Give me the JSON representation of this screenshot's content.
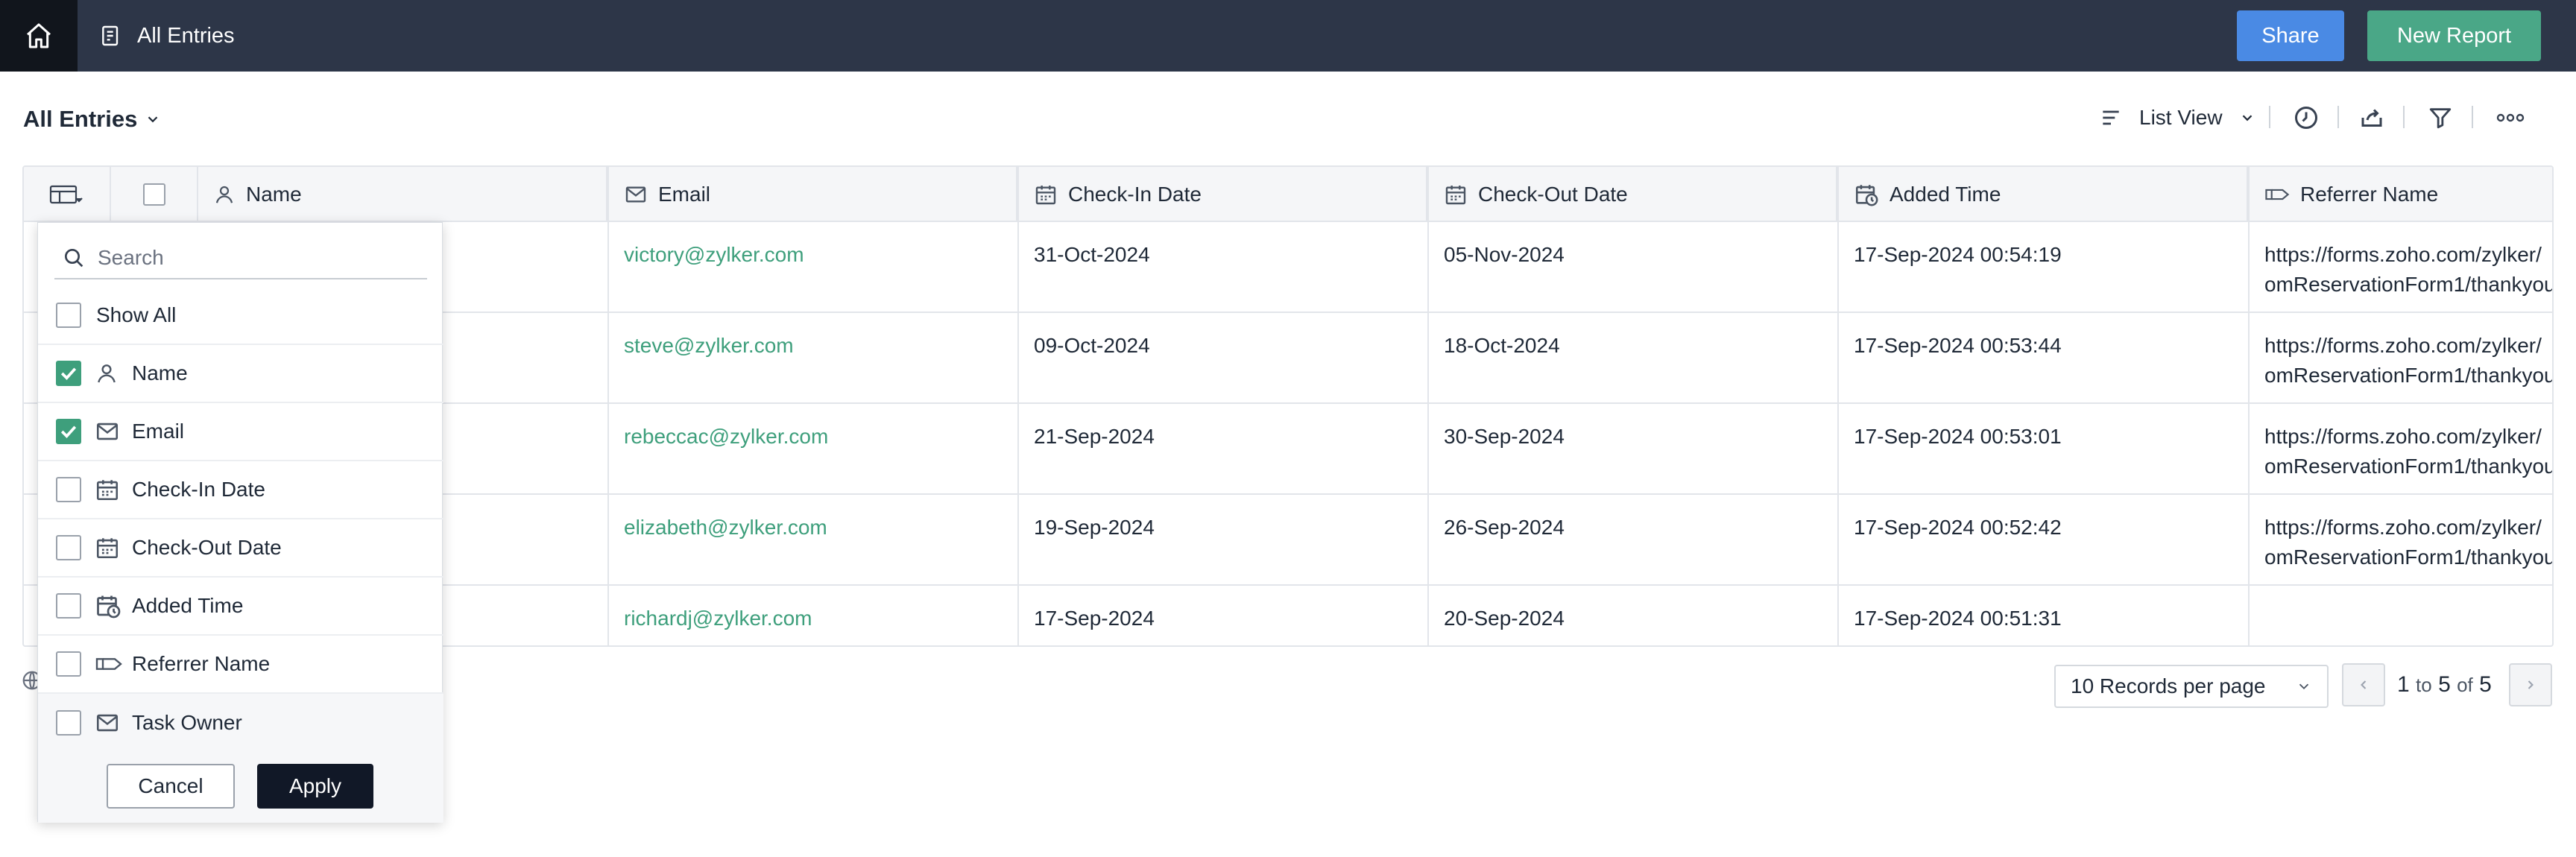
{
  "topbar": {
    "title": "All Entries",
    "share_label": "Share",
    "new_report_label": "New Report"
  },
  "view": {
    "title": "All Entries",
    "list_view_label": "List View"
  },
  "table": {
    "columns": [
      {
        "label": "Name",
        "icon": "person-icon"
      },
      {
        "label": "Email",
        "icon": "mail-icon"
      },
      {
        "label": "Check-In Date",
        "icon": "calendar-icon"
      },
      {
        "label": "Check-Out Date",
        "icon": "calendar-icon"
      },
      {
        "label": "Added Time",
        "icon": "calendar-clock-icon"
      },
      {
        "label": "Referrer Name",
        "icon": "referrer-icon"
      }
    ],
    "rows": [
      {
        "email": "victory@zylker.com",
        "checkin": "31-Oct-2024",
        "checkout": "05-Nov-2024",
        "added": "17-Sep-2024 00:54:19",
        "ref1": "https://forms.zoho.com/zylker/",
        "ref2": "omReservationForm1/thankyou"
      },
      {
        "email": "steve@zylker.com",
        "checkin": "09-Oct-2024",
        "checkout": "18-Oct-2024",
        "added": "17-Sep-2024 00:53:44",
        "ref1": "https://forms.zoho.com/zylker/",
        "ref2": "omReservationForm1/thankyou"
      },
      {
        "email": "rebeccac@zylker.com",
        "checkin": "21-Sep-2024",
        "checkout": "30-Sep-2024",
        "added": "17-Sep-2024 00:53:01",
        "ref1": "https://forms.zoho.com/zylker/",
        "ref2": "omReservationForm1/thankyou"
      },
      {
        "email": "elizabeth@zylker.com",
        "checkin": "19-Sep-2024",
        "checkout": "26-Sep-2024",
        "added": "17-Sep-2024 00:52:42",
        "ref1": "https://forms.zoho.com/zylker/",
        "ref2": "omReservationForm1/thankyou"
      },
      {
        "email": "richardj@zylker.com",
        "checkin": "17-Sep-2024",
        "checkout": "20-Sep-2024",
        "added": "17-Sep-2024 00:51:31",
        "ref1": "",
        "ref2": ""
      }
    ]
  },
  "pagination": {
    "per_page": "10 Records per page",
    "from": "1",
    "to_word": "to",
    "to": "5",
    "of_word": "of",
    "total": "5"
  },
  "column_picker": {
    "search_placeholder": "Search",
    "show_all": "Show All",
    "options": [
      {
        "label": "Name",
        "icon": "person-icon",
        "checked": true
      },
      {
        "label": "Email",
        "icon": "mail-icon",
        "checked": true
      },
      {
        "label": "Check-In Date",
        "icon": "calendar-icon",
        "checked": false
      },
      {
        "label": "Check-Out Date",
        "icon": "calendar-icon",
        "checked": false
      },
      {
        "label": "Added Time",
        "icon": "calendar-clock-icon",
        "checked": false
      },
      {
        "label": "Referrer Name",
        "icon": "referrer-icon",
        "checked": false
      },
      {
        "label": "Task Owner",
        "icon": "mail-icon",
        "checked": false
      }
    ],
    "cancel_label": "Cancel",
    "apply_label": "Apply"
  },
  "colors": {
    "topbar": "#2d3648",
    "share": "#4a8ae4",
    "new_report": "#4aa787",
    "email_link": "#3e9f7c",
    "checkbox_on": "#3e9f7c"
  }
}
